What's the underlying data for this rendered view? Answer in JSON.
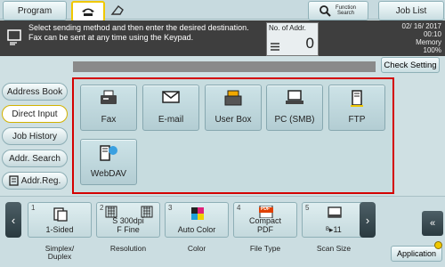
{
  "topbar": {
    "program_label": "Program",
    "function_search_label": "Function Search",
    "job_list_label": "Job List"
  },
  "message": {
    "line1": "Select sending method and then enter the desired destination.",
    "line2": "Fax can be sent at any time using the Keypad."
  },
  "addr_counter": {
    "label": "No. of Addr.",
    "value": "0"
  },
  "status": {
    "date": "02/ 16/ 2017",
    "time": "00:10",
    "memory_label": "Memory",
    "memory_value": "100%"
  },
  "check_setting_label": "Check Setting",
  "sidebar": [
    {
      "label": "Address Book"
    },
    {
      "label": "Direct Input"
    },
    {
      "label": "Job History"
    },
    {
      "label": "Addr. Search"
    },
    {
      "label": "Addr.Reg."
    }
  ],
  "destinations": [
    {
      "label": "Fax",
      "icon": "fax-icon"
    },
    {
      "label": "E-mail",
      "icon": "envelope-icon"
    },
    {
      "label": "User Box",
      "icon": "user-box-icon"
    },
    {
      "label": "PC (SMB)",
      "icon": "pc-icon"
    },
    {
      "label": "FTP",
      "icon": "ftp-icon"
    },
    {
      "label": "WebDAV",
      "icon": "webdav-icon"
    }
  ],
  "settings": [
    {
      "num": "1",
      "value": "1-Sided",
      "caption": "Simplex/\nDuplex"
    },
    {
      "num": "2",
      "value": "S 300dpi\nF Fine",
      "caption": "Resolution"
    },
    {
      "num": "3",
      "value": "Auto Color",
      "caption": "Color"
    },
    {
      "num": "4",
      "value": "Compact\nPDF",
      "caption": "File Type",
      "badge": "PDF"
    },
    {
      "num": "5",
      "value": "ᴮ▸11",
      "caption": "Scan Size"
    }
  ],
  "application_label": "Application",
  "colors": {
    "highlight_border": "#d40000",
    "accent_yellow": "#f0c800"
  }
}
